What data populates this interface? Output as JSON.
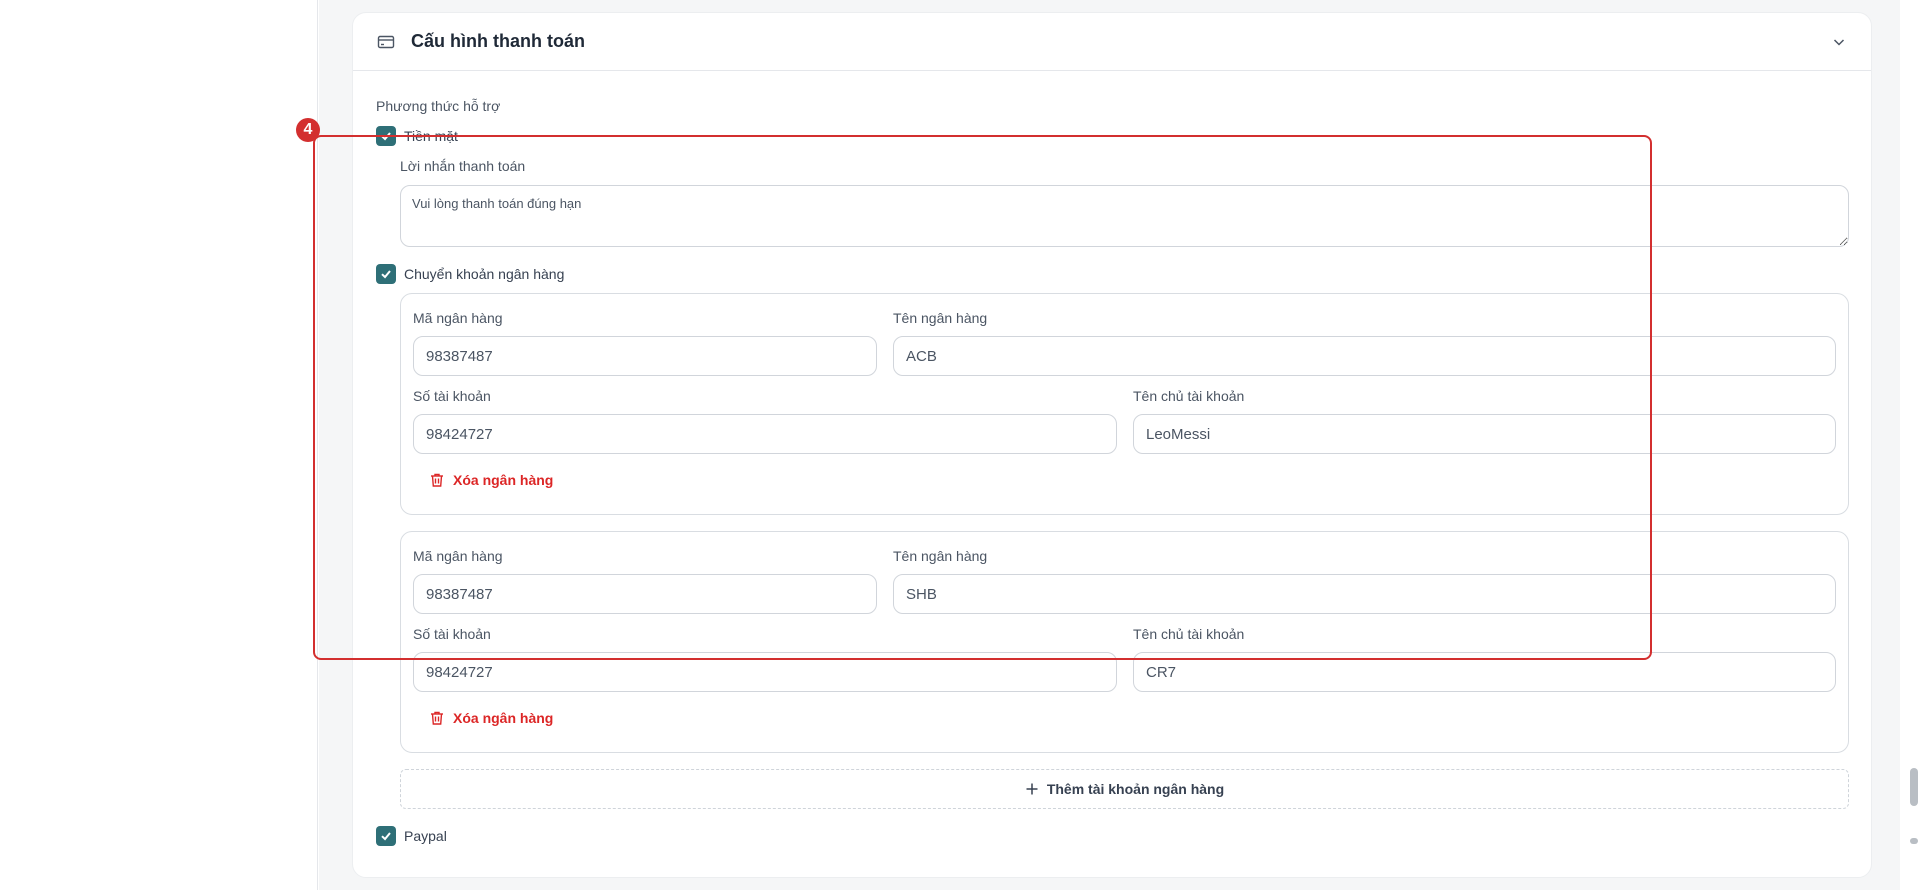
{
  "section": {
    "title": "Cấu hình thanh toán",
    "icon": "credit-card-icon",
    "collapse_icon": "chevron-down-icon"
  },
  "payment": {
    "methods_label": "Phương thức hỗ trợ",
    "cash": {
      "label": "Tiền mặt",
      "checked": true,
      "message_label": "Lời nhắn thanh toán",
      "message_value": "Vui lòng thanh toán đúng hạn"
    },
    "bank_transfer": {
      "label": "Chuyển khoản ngân hàng",
      "checked": true,
      "field_labels": {
        "bank_code": "Mã ngân hàng",
        "bank_name": "Tên ngân hàng",
        "account_number": "Số tài khoản",
        "account_holder": "Tên chủ tài khoản"
      },
      "banks": [
        {
          "bank_code": "98387487",
          "bank_name": "ACB",
          "account_number": "98424727",
          "account_holder": "LeoMessi",
          "delete_label": "Xóa ngân hàng"
        },
        {
          "bank_code": "98387487",
          "bank_name": "SHB",
          "account_number": "98424727",
          "account_holder": "CR7",
          "delete_label": "Xóa ngân hàng"
        }
      ],
      "add_label": "Thêm tài khoản ngân hàng"
    },
    "paypal": {
      "label": "Paypal",
      "checked": true
    }
  },
  "annotation": {
    "number": "4",
    "color": "#d32f2f"
  },
  "colors": {
    "checkbox": "#2e6f77",
    "danger": "#dc2626"
  }
}
